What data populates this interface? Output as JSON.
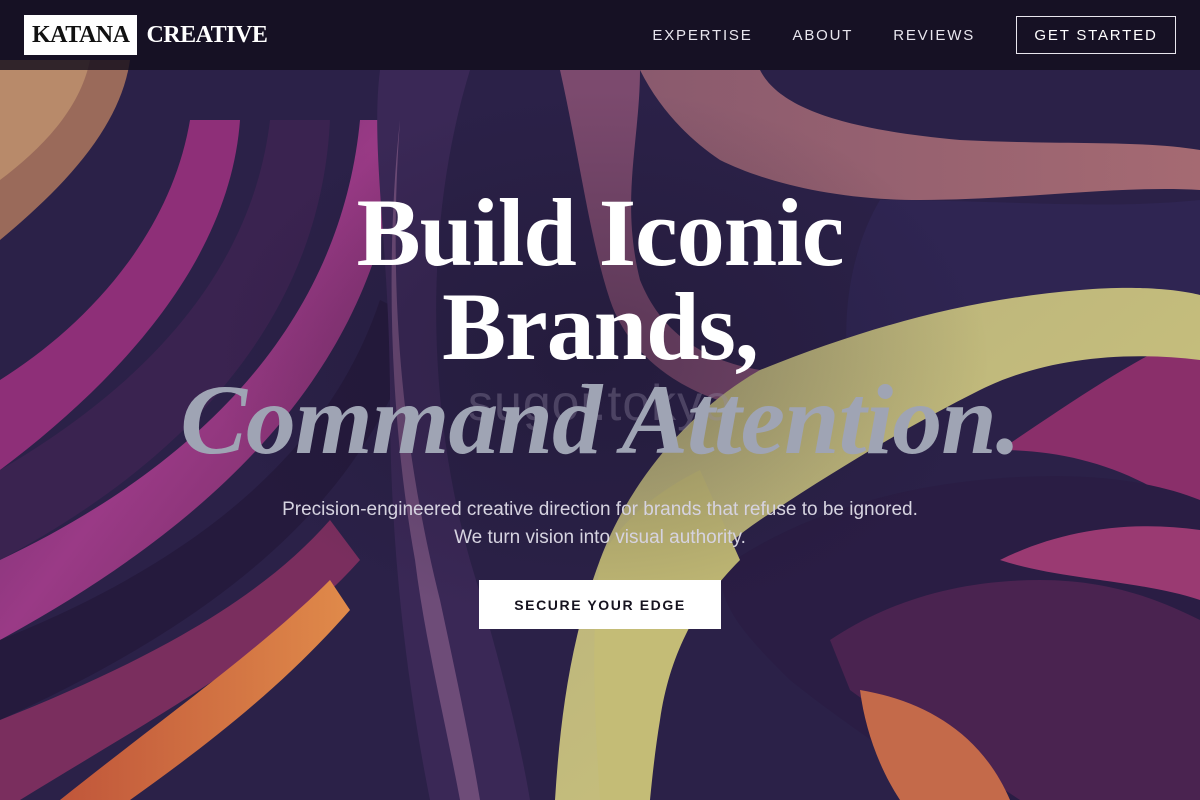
{
  "brand": {
    "logo_box_text": "KATANA",
    "logo_text": "CREATIVE"
  },
  "nav": {
    "links": [
      "EXPERTISE",
      "ABOUT",
      "REVIEWS"
    ],
    "cta_label": "GET STARTED"
  },
  "hero": {
    "headline_line1": "Build Iconic",
    "headline_line2": "Brands,",
    "headline_line3": "Command Attention.",
    "watermark": "sugoi.tokyo",
    "subtitle": "Precision-engineered creative direction for brands that refuse to be ignored. We turn vision into visual authority.",
    "cta_label": "SECURE YOUR EDGE"
  },
  "colors": {
    "nav_bg": "#120e1c",
    "headline": "#ffffff",
    "headline_accent": "#9fa4b4",
    "cta_bg": "#ffffff",
    "cta_text": "#16131f",
    "bg_purple": "#2a1f45",
    "bg_magenta": "#8e2f78",
    "bg_yellow": "#c8c27a"
  }
}
